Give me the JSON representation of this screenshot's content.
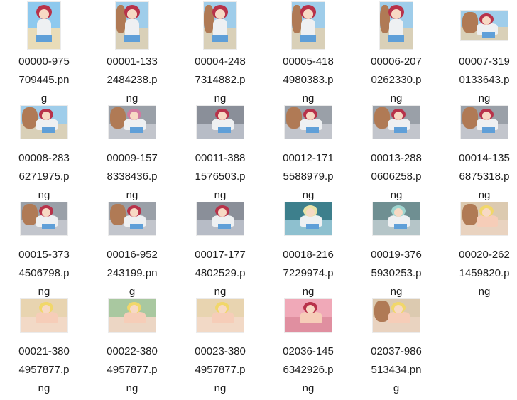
{
  "files": [
    {
      "name": "00000-975709445.png",
      "orientation": "portrait",
      "scene": "beach",
      "hair": "#b8324a"
    },
    {
      "name": "00001-1332484238.png",
      "orientation": "portrait",
      "scene": "beach-man",
      "hair": "#b8324a"
    },
    {
      "name": "00004-2487314882.png",
      "orientation": "portrait",
      "scene": "beach-man",
      "hair": "#b8324a"
    },
    {
      "name": "00005-4184980383.png",
      "orientation": "portrait",
      "scene": "beach-man",
      "hair": "#b8324a"
    },
    {
      "name": "00006-2070262330.png",
      "orientation": "portrait",
      "scene": "beach-man",
      "hair": "#b8324a"
    },
    {
      "name": "00007-3190133643.png",
      "orientation": "land-small",
      "scene": "beach-man",
      "hair": "#b8324a"
    },
    {
      "name": "00008-2836271975.png",
      "orientation": "landscape",
      "scene": "beach-man",
      "hair": "#b8324a"
    },
    {
      "name": "00009-1578338436.png",
      "orientation": "landscape",
      "scene": "grey-man",
      "hair": "#d07aa0"
    },
    {
      "name": "00011-3881576503.png",
      "orientation": "landscape",
      "scene": "grey",
      "hair": "#b8324a"
    },
    {
      "name": "00012-1715588979.png",
      "orientation": "landscape",
      "scene": "grey-man",
      "hair": "#b8324a"
    },
    {
      "name": "00013-2880606258.png",
      "orientation": "landscape",
      "scene": "grey-man",
      "hair": "#b8324a"
    },
    {
      "name": "00014-1356875318.png",
      "orientation": "landscape",
      "scene": "grey-man",
      "hair": "#b8324a"
    },
    {
      "name": "00015-3734506798.png",
      "orientation": "landscape",
      "scene": "grey-man",
      "hair": "#b8324a"
    },
    {
      "name": "00016-952243199.png",
      "orientation": "landscape",
      "scene": "grey-man",
      "hair": "#b8324a"
    },
    {
      "name": "00017-1774802529.png",
      "orientation": "landscape",
      "scene": "grey",
      "hair": "#b8324a"
    },
    {
      "name": "00018-2167229974.png",
      "orientation": "landscape",
      "scene": "teal",
      "hair": "#e9e3a8"
    },
    {
      "name": "00019-3765930253.png",
      "orientation": "landscape",
      "scene": "teal-grey",
      "hair": "#9fd6d0"
    },
    {
      "name": "00020-2621459820.png",
      "orientation": "landscape",
      "scene": "blonde-man",
      "hair": "#f1d76a"
    },
    {
      "name": "00021-3804957877.png",
      "orientation": "landscape",
      "scene": "blonde",
      "hair": "#f1d76a"
    },
    {
      "name": "00022-3804957877.png",
      "orientation": "landscape",
      "scene": "blonde-green",
      "hair": "#f1d76a"
    },
    {
      "name": "00023-3804957877.png",
      "orientation": "landscape",
      "scene": "blonde",
      "hair": "#f1d76a"
    },
    {
      "name": "02036-1456342926.png",
      "orientation": "landscape",
      "scene": "pink",
      "hair": "#b8324a"
    },
    {
      "name": "02037-986513434.png",
      "orientation": "landscape",
      "scene": "blonde-man",
      "hair": "#f1d76a"
    }
  ],
  "label_lines": [
    [
      "00000-975",
      "709445.pn",
      "g"
    ],
    [
      "00001-133",
      "2484238.p",
      "ng"
    ],
    [
      "00004-248",
      "7314882.p",
      "ng"
    ],
    [
      "00005-418",
      "4980383.p",
      "ng"
    ],
    [
      "00006-207",
      "0262330.p",
      "ng"
    ],
    [
      "00007-319",
      "0133643.p",
      "ng"
    ],
    [
      "00008-283",
      "6271975.p",
      "ng"
    ],
    [
      "00009-157",
      "8338436.p",
      "ng"
    ],
    [
      "00011-388",
      "1576503.p",
      "ng"
    ],
    [
      "00012-171",
      "5588979.p",
      "ng"
    ],
    [
      "00013-288",
      "0606258.p",
      "ng"
    ],
    [
      "00014-135",
      "6875318.p",
      "ng"
    ],
    [
      "00015-373",
      "4506798.p",
      "ng"
    ],
    [
      "00016-952",
      "243199.pn",
      "g"
    ],
    [
      "00017-177",
      "4802529.p",
      "ng"
    ],
    [
      "00018-216",
      "7229974.p",
      "ng"
    ],
    [
      "00019-376",
      "5930253.p",
      "ng"
    ],
    [
      "00020-262",
      "1459820.p",
      "ng"
    ],
    [
      "00021-380",
      "4957877.p",
      "ng"
    ],
    [
      "00022-380",
      "4957877.p",
      "ng"
    ],
    [
      "00023-380",
      "4957877.p",
      "ng"
    ],
    [
      "02036-145",
      "6342926.p",
      "ng"
    ],
    [
      "02037-986",
      "513434.pn",
      "g"
    ]
  ]
}
